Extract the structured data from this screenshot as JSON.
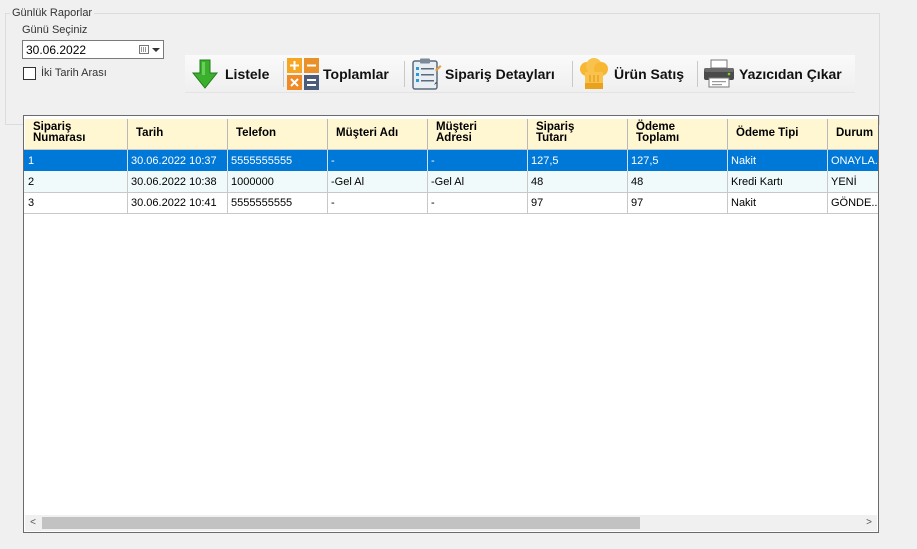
{
  "groupbox": {
    "title": "Günlük Raporlar",
    "date_label": "Günü Seçiniz",
    "date_value": "30.06.2022",
    "range_checkbox_label": "İki Tarih Arası",
    "range_checked": false
  },
  "toolbar": {
    "list_label": "Listele",
    "totals_label": "Toplamlar",
    "order_details_label": "Sipariş Detayları",
    "product_sales_label": "Ürün Satış",
    "print_label": "Yazıcıdan Çıkar"
  },
  "grid": {
    "headers": [
      [
        "Sipariş",
        "Numarası"
      ],
      [
        "Tarih"
      ],
      [
        "Telefon"
      ],
      [
        "Müşteri Adı"
      ],
      [
        "Müşteri",
        "Adresi"
      ],
      [
        "Sipariş",
        "Tutarı"
      ],
      [
        "Ödeme",
        "Toplamı"
      ],
      [
        "Ödeme Tipi"
      ],
      [
        "Durum"
      ]
    ],
    "rows": [
      [
        "1",
        "30.06.2022 10:37",
        "5555555555",
        "-",
        "-",
        "127,5",
        "127,5",
        "Nakit",
        "ONAYLA..."
      ],
      [
        "2",
        "30.06.2022 10:38",
        "1000000",
        "-Gel Al",
        "-Gel Al",
        "48",
        "48",
        "Kredi Kartı",
        "YENİ"
      ],
      [
        "3",
        "30.06.2022 10:41",
        "5555555555",
        "-",
        "-",
        "97",
        "97",
        "Nakit",
        "GÖNDE..."
      ]
    ],
    "selected_row": 0,
    "colors": {
      "header_bg": "#fff7d1",
      "selected_bg": "#0078d7",
      "alt_row_bg": "#f0fafa"
    }
  }
}
